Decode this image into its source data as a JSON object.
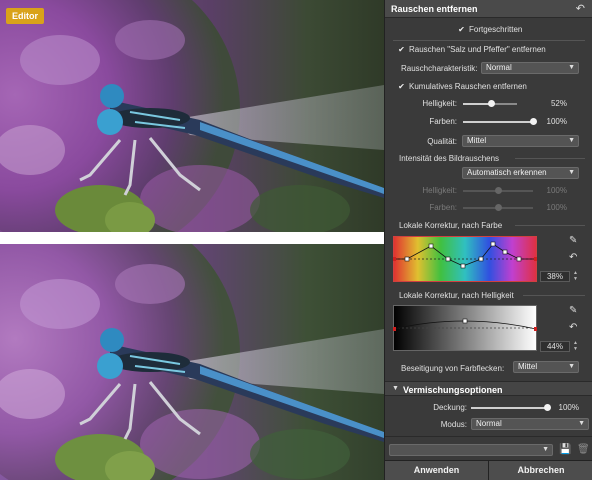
{
  "badge": {
    "label": "Editor"
  },
  "panel": {
    "title": "Rauschen entfernen",
    "advanced": {
      "label": "Fortgeschritten",
      "checked": true
    },
    "salt_pepper": {
      "label": "Rauschen \"Salz und Pfeffer\" entfernen",
      "checked": true
    },
    "noise_char": {
      "label": "Rauschcharakteristik:",
      "value": "Normal"
    },
    "cumulative": {
      "label": "Kumulatives Rauschen entfernen",
      "checked": true
    },
    "brightness": {
      "label": "Helligkeit:",
      "value_text": "52%",
      "value": 0.52
    },
    "colors": {
      "label": "Farben:",
      "value_text": "100%",
      "value": 1.0
    },
    "quality": {
      "label": "Qualität:",
      "value": "Mittel"
    },
    "intensity": {
      "label": "Intensität des Bildrauschens",
      "value": "Automatisch erkennen"
    },
    "dis_brightness": {
      "label": "Helligkeit:",
      "value_text": "100%",
      "value": 0.5
    },
    "dis_colors": {
      "label": "Farben:",
      "value_text": "100%",
      "value": 0.5
    },
    "local_color": {
      "label": "Lokale Korrektur, nach Farbe",
      "pct": "38%"
    },
    "local_bright": {
      "label": "Lokale Korrektur, nach Helligkeit",
      "pct": "44%"
    },
    "stains": {
      "label": "Beseitigung von Farbflecken:",
      "value": "Mittel"
    }
  },
  "blend": {
    "title": "Vermischungsoptionen",
    "opacity": {
      "label": "Deckung:",
      "value_text": "100%",
      "value": 1.0
    },
    "mode": {
      "label": "Modus:",
      "value": "Normal"
    }
  },
  "preset": {
    "value": ""
  },
  "footer": {
    "apply": "Anwenden",
    "cancel": "Abbrechen"
  },
  "colors": {
    "accent": "#d9a21a",
    "panel": "#3a3a3a",
    "curve_border": "#d04040"
  }
}
